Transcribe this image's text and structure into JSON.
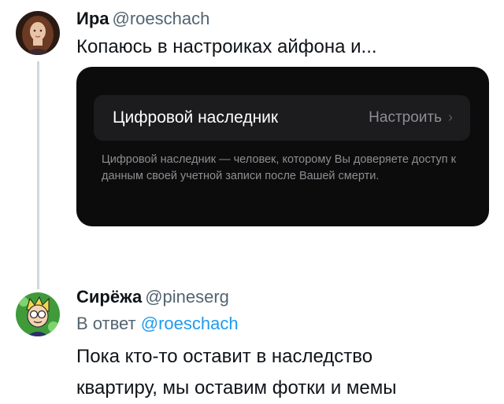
{
  "tweet1": {
    "name": "Ира",
    "handle": "@roeschach",
    "text": "Копаюсь в настроиках айфона и..."
  },
  "embed": {
    "setting_label": "Цифровой наследник",
    "setting_action": "Настроить",
    "chevron": "›",
    "description": "Цифровой наследник — человек, которому Вы доверяете доступ к данным своей учетной записи после Вашей смерти."
  },
  "tweet2": {
    "name": "Сирёжа",
    "handle": "@pineserg",
    "reply_prefix": "В ответ",
    "reply_handle": "@roeschach",
    "text_line1": "Пока кто-то оставит в наследство",
    "text_line2": "квартиру, мы оставим фотки и мемы"
  },
  "icons": {
    "avatar1": "woman-portrait-avatar",
    "avatar2": "cartoon-boy-avatar"
  }
}
